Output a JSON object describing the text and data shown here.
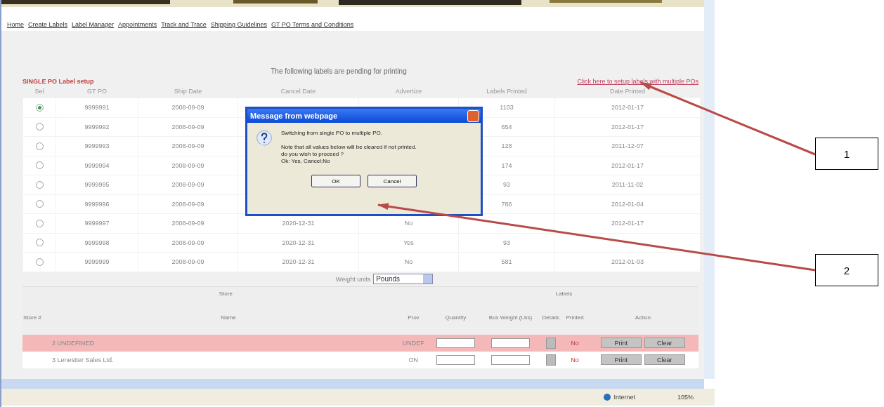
{
  "nav_links": [
    "Home",
    "Create Labels",
    "Label Manager",
    "Appointments",
    "Track and Trace",
    "Shipping Guidelines",
    "GT PO Terms and Conditions"
  ],
  "pending_title": "The following labels are pending for printing",
  "section_title": "SINGLE PO Label setup",
  "multi_po_link": "Click here to setup labels with multiple POs",
  "po_table": {
    "columns": [
      "Sel",
      "GT PO",
      "Ship Date",
      "Cancel Date",
      "Advertize",
      "Labels Printed",
      "Date Printed"
    ],
    "rows": [
      {
        "selected": true,
        "gt_po": "9999991",
        "ship_date": "2008-09-09",
        "labels_printed": "1103",
        "date_printed": "2012-01-17"
      },
      {
        "selected": false,
        "gt_po": "9999992",
        "ship_date": "2008-09-09",
        "labels_printed": "654",
        "date_printed": "2012-01-17"
      },
      {
        "selected": false,
        "gt_po": "9999993",
        "ship_date": "2008-09-09",
        "labels_printed": "128",
        "date_printed": "2011-12-07"
      },
      {
        "selected": false,
        "gt_po": "9999994",
        "ship_date": "2008-09-09",
        "labels_printed": "174",
        "date_printed": "2012-01-17"
      },
      {
        "selected": false,
        "gt_po": "9999995",
        "ship_date": "2008-09-09",
        "labels_printed": "93",
        "date_printed": "2011-11-02"
      },
      {
        "selected": false,
        "gt_po": "9999996",
        "ship_date": "2008-09-09",
        "labels_printed": "786",
        "date_printed": "2012-01-04"
      },
      {
        "selected": false,
        "gt_po": "9999997",
        "ship_date": "2008-09-09",
        "cancel_date": "2020-12-31",
        "advertize": "No",
        "date_printed": "2012-01-17"
      },
      {
        "selected": false,
        "gt_po": "9999998",
        "ship_date": "2008-09-09",
        "cancel_date": "2020-12-31",
        "advertize": "Yes",
        "labels_printed": "93"
      },
      {
        "selected": false,
        "gt_po": "9999999",
        "ship_date": "2008-09-09",
        "cancel_date": "2020-12-31",
        "advertize": "No",
        "labels_printed": "581",
        "date_printed": "2012-01-03"
      }
    ]
  },
  "weight_units": {
    "label": "Weight units",
    "value": "Pounds"
  },
  "store_table": {
    "group_headers": [
      "Store",
      "Labels"
    ],
    "columns": [
      "Store #",
      "Name",
      "Prov",
      "Quantity",
      "Box Weight (Lbs)",
      "Details",
      "Printed",
      "Action"
    ],
    "rows": [
      {
        "highlighted": true,
        "store_no": "2",
        "name": "UNDEFINED",
        "prov": "UNDEF",
        "printed": "No",
        "buttons": [
          "Print",
          "Clear"
        ]
      },
      {
        "highlighted": false,
        "store_no": "3",
        "name": "Lenestter Sales Ltd.",
        "prov": "ON",
        "printed": "No",
        "buttons": [
          "Print",
          "Clear"
        ]
      }
    ]
  },
  "status_bar": {
    "zone": "Internet",
    "zoom": "105%"
  },
  "dialog": {
    "title": "Message from webpage",
    "lines": [
      "Switching from single PO to multiple PO.",
      "Note that all values below will be cleared if not printed.",
      "do you wish to proceed ?",
      "Ok: Yes, Cancel:No"
    ],
    "buttons": [
      "OK",
      "Cancel"
    ]
  },
  "callouts": [
    "1",
    "2"
  ]
}
